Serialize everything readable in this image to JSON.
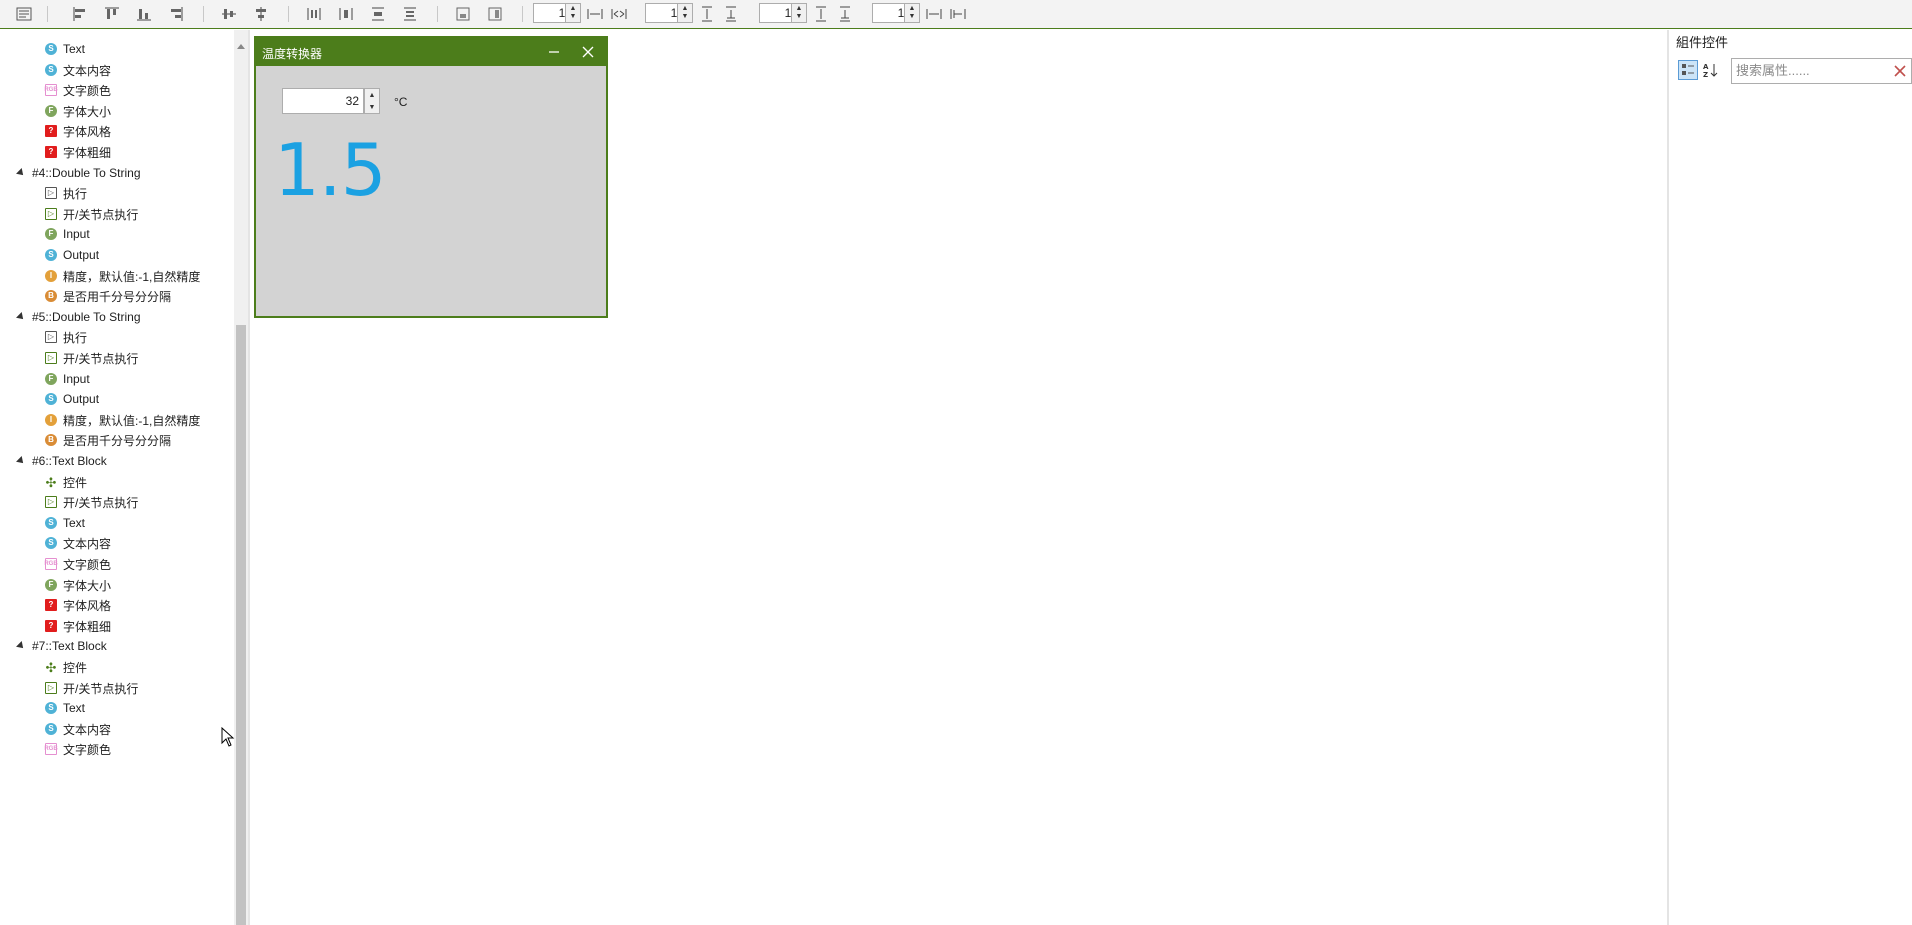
{
  "colors": {
    "accent": "#4c7d1b",
    "value_text": "#1ba1e2",
    "canvas_bg": "#d3d3d3"
  },
  "toolbar": {
    "icons": [
      "document-icon",
      "align-left-icon",
      "align-top-icon",
      "align-bottom-icon",
      "align-right-icon",
      "center-horizontal-icon",
      "center-vertical-icon",
      "distribute-horizontal-icon",
      "distribute-horizontal-2-icon",
      "distribute-vertical-icon",
      "distribute-vertical-2-icon",
      "fit-width-icon",
      "fit-height-icon"
    ],
    "spacing_1": "10",
    "spacing_2": "10",
    "spacing_3": "10",
    "spacing_4": "10"
  },
  "tree": {
    "rows": [
      {
        "kind": "child",
        "icon": "string",
        "label": "Text"
      },
      {
        "kind": "child",
        "icon": "string",
        "label": "文本内容"
      },
      {
        "kind": "child",
        "icon": "color",
        "label": "文字颜色"
      },
      {
        "kind": "child",
        "icon": "float",
        "label": "字体大小"
      },
      {
        "kind": "child",
        "icon": "unknown",
        "label": "字体风格"
      },
      {
        "kind": "child",
        "icon": "unknown",
        "label": "字体粗细"
      },
      {
        "kind": "group",
        "label": "#4::Double To String"
      },
      {
        "kind": "child",
        "icon": "exec",
        "label": "执行"
      },
      {
        "kind": "child",
        "icon": "toggle-exec",
        "label": "开/关节点执行"
      },
      {
        "kind": "child",
        "icon": "float",
        "label": "Input"
      },
      {
        "kind": "child",
        "icon": "string",
        "label": "Output"
      },
      {
        "kind": "child",
        "icon": "int",
        "label": "精度，默认值:-1,自然精度"
      },
      {
        "kind": "child",
        "icon": "bool",
        "label": "是否用千分号分分隔"
      },
      {
        "kind": "group",
        "label": "#5::Double To String"
      },
      {
        "kind": "child",
        "icon": "exec",
        "label": "执行"
      },
      {
        "kind": "child",
        "icon": "toggle-exec",
        "label": "开/关节点执行"
      },
      {
        "kind": "child",
        "icon": "float",
        "label": "Input"
      },
      {
        "kind": "child",
        "icon": "string",
        "label": "Output"
      },
      {
        "kind": "child",
        "icon": "int",
        "label": "精度，默认值:-1,自然精度"
      },
      {
        "kind": "child",
        "icon": "bool",
        "label": "是否用千分号分分隔"
      },
      {
        "kind": "group",
        "label": "#6::Text Block"
      },
      {
        "kind": "child",
        "icon": "control",
        "label": "控件"
      },
      {
        "kind": "child",
        "icon": "toggle-exec",
        "label": "开/关节点执行"
      },
      {
        "kind": "child",
        "icon": "string",
        "label": "Text"
      },
      {
        "kind": "child",
        "icon": "string",
        "label": "文本内容"
      },
      {
        "kind": "child",
        "icon": "color",
        "label": "文字颜色"
      },
      {
        "kind": "child",
        "icon": "float",
        "label": "字体大小"
      },
      {
        "kind": "child",
        "icon": "unknown",
        "label": "字体风格"
      },
      {
        "kind": "child",
        "icon": "unknown",
        "label": "字体粗细"
      },
      {
        "kind": "group",
        "label": "#7::Text Block"
      },
      {
        "kind": "child",
        "icon": "control",
        "label": "控件"
      },
      {
        "kind": "child",
        "icon": "toggle-exec",
        "label": "开/关节点执行"
      },
      {
        "kind": "child",
        "icon": "string",
        "label": "Text"
      },
      {
        "kind": "child",
        "icon": "string",
        "label": "文本内容"
      },
      {
        "kind": "child",
        "icon": "color",
        "label": "文字颜色"
      }
    ]
  },
  "canvas": {
    "window_title": "温度转换器",
    "input_value": "32",
    "unit": "°C",
    "result": "1.5"
  },
  "props_panel": {
    "title": "組件控件",
    "search_placeholder": "搜索属性......"
  }
}
